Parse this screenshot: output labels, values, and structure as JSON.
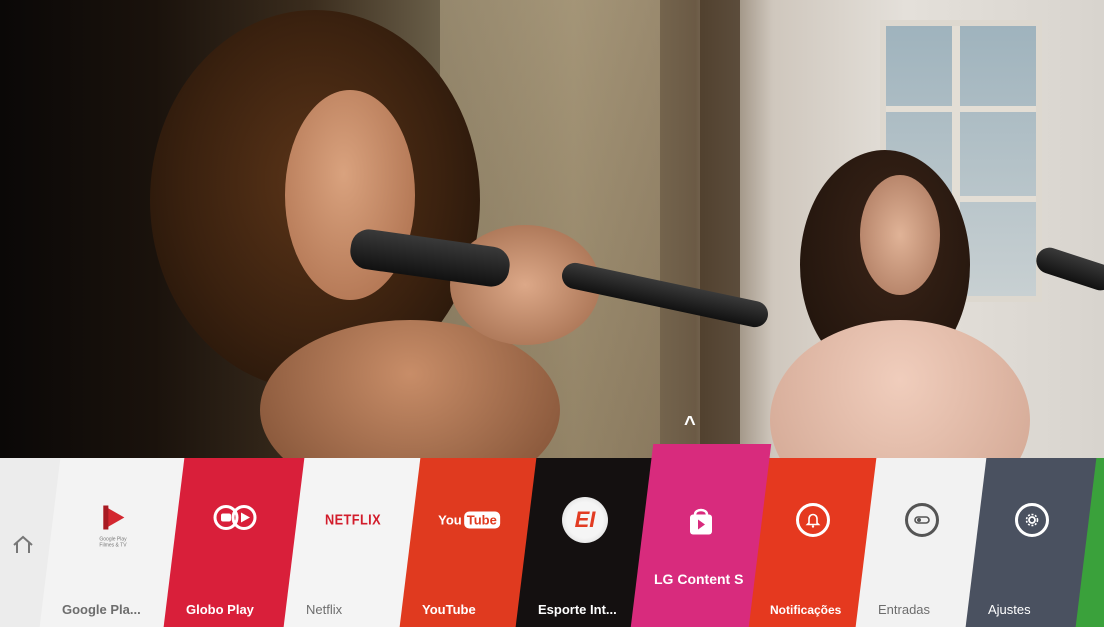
{
  "launcher": {
    "home_icon": "home-icon",
    "tiles": [
      {
        "label": "Google Pla...",
        "icon": "google-play-icon",
        "icon_caption": "Google Play\nFilmes & TV",
        "color": "#f3f3f3"
      },
      {
        "label": "Globo Play",
        "icon": "globo-play-icon",
        "color": "#d91f3a"
      },
      {
        "label": "Netflix",
        "icon": "netflix-logo",
        "logo_text": "NETFLIX",
        "color": "#f4f4f4"
      },
      {
        "label": "YouTube",
        "icon": "youtube-logo",
        "logo_you": "You",
        "logo_tube": "Tube",
        "color": "#e03a1f"
      },
      {
        "label": "Esporte Int...",
        "icon": "esporte-interativo-icon",
        "logo_text": "EI",
        "color": "#141010"
      },
      {
        "label": "LG Content S",
        "icon": "lg-content-store-icon",
        "color": "#d82b7d",
        "selected": true
      },
      {
        "label": "Notificações",
        "icon": "bell-icon",
        "color": "#e5391f"
      },
      {
        "label": "Entradas",
        "icon": "input-icon",
        "color": "#f2f2f2"
      },
      {
        "label": "Ajustes",
        "icon": "gear-icon",
        "color": "#4a5160"
      }
    ],
    "up_arrow": "^",
    "accent_green": "#3aa13b"
  }
}
